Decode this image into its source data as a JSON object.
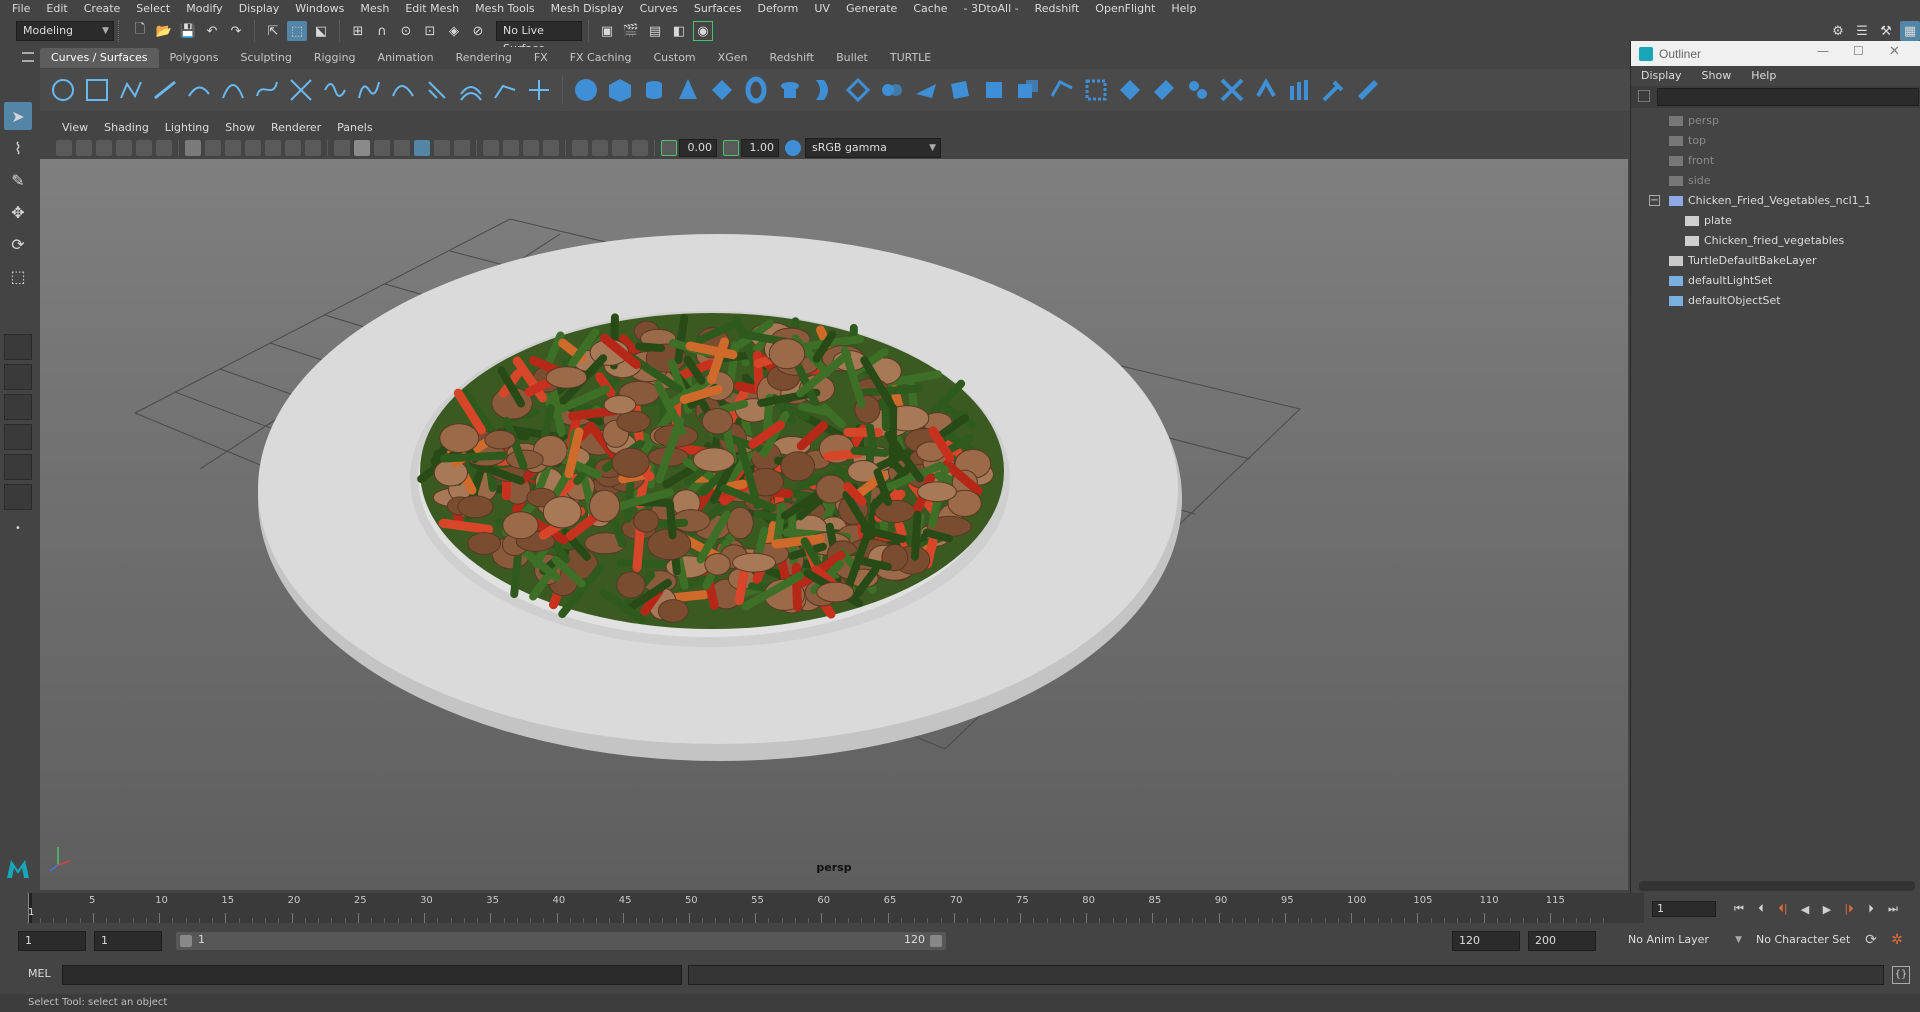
{
  "menubar": {
    "items": [
      "File",
      "Edit",
      "Create",
      "Select",
      "Modify",
      "Display",
      "Windows",
      "Mesh",
      "Edit Mesh",
      "Mesh Tools",
      "Mesh Display",
      "Curves",
      "Surfaces",
      "Deform",
      "UV",
      "Generate",
      "Cache",
      "- 3DtoAll -",
      "Redshift",
      "OpenFlight",
      "Help"
    ]
  },
  "statusline": {
    "workspace": "Modeling",
    "live_surface": "No Live Surface"
  },
  "shelf": {
    "tabs": [
      "Curves / Surfaces",
      "Polygons",
      "Sculpting",
      "Rigging",
      "Animation",
      "Rendering",
      "FX",
      "FX Caching",
      "Custom",
      "XGen",
      "Redshift",
      "Bullet",
      "TURTLE"
    ],
    "active_tab": "Curves / Surfaces"
  },
  "panel": {
    "menus": [
      "View",
      "Shading",
      "Lighting",
      "Show",
      "Renderer",
      "Panels"
    ],
    "exposure": "0.00",
    "gamma": "1.00",
    "color_space": "sRGB gamma",
    "camera_label": "persp"
  },
  "outliner": {
    "title": "Outliner",
    "menus": [
      "Display",
      "Show",
      "Help"
    ],
    "items": [
      {
        "label": "persp",
        "indent": 0,
        "dim": true,
        "icon": "camera-icon"
      },
      {
        "label": "top",
        "indent": 0,
        "dim": true,
        "icon": "camera-icon"
      },
      {
        "label": "front",
        "indent": 0,
        "dim": true,
        "icon": "camera-icon"
      },
      {
        "label": "side",
        "indent": 0,
        "dim": true,
        "icon": "camera-icon"
      },
      {
        "label": "Chicken_Fried_Vegetables_ncl1_1",
        "indent": 0,
        "dim": false,
        "icon": "group-icon",
        "expanded": true
      },
      {
        "label": "plate",
        "indent": 1,
        "dim": false,
        "icon": "mesh-icon"
      },
      {
        "label": "Chicken_fried_vegetables",
        "indent": 1,
        "dim": false,
        "icon": "mesh-icon"
      },
      {
        "label": "TurtleDefaultBakeLayer",
        "indent": 0,
        "dim": false,
        "icon": "layer-icon"
      },
      {
        "label": "defaultLightSet",
        "indent": 0,
        "dim": false,
        "icon": "set-icon"
      },
      {
        "label": "defaultObjectSet",
        "indent": 0,
        "dim": false,
        "icon": "set-icon"
      }
    ]
  },
  "timeslider": {
    "ticks": [
      "5",
      "10",
      "15",
      "20",
      "25",
      "30",
      "35",
      "40",
      "45",
      "50",
      "55",
      "60",
      "65",
      "70",
      "75",
      "80",
      "85",
      "90",
      "95",
      "100",
      "105",
      "110",
      "115"
    ],
    "current_frame": "1",
    "frame_field": "1"
  },
  "rangeslider": {
    "start": "1",
    "anim_start": "1",
    "range_start": "1",
    "range_end": "120",
    "end": "120",
    "anim_end": "200",
    "anim_layer": "No Anim Layer",
    "character_set": "No Character Set"
  },
  "cmdline": {
    "label": "MEL"
  },
  "helpline": {
    "text": "Select Tool: select an object"
  },
  "colors": {
    "accent": "#5285a6",
    "viewport_top": "#7f7f7f",
    "viewport_bottom": "#5e5e5e",
    "plate": "#d9d9d9"
  }
}
